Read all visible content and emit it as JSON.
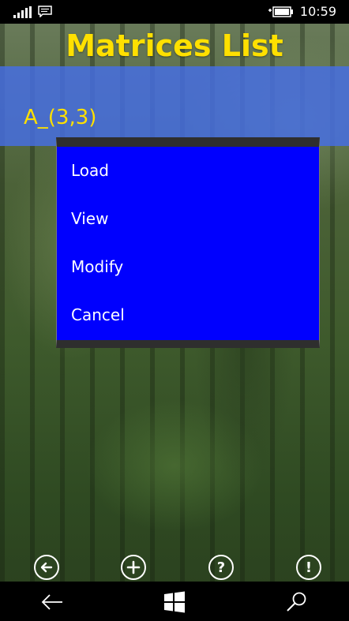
{
  "status_bar": {
    "time": "10:59"
  },
  "page": {
    "title": "Matrices List"
  },
  "list": {
    "items": [
      {
        "label": "A_(3,3)"
      }
    ]
  },
  "context_menu": {
    "items": [
      {
        "label": "Load"
      },
      {
        "label": "View"
      },
      {
        "label": "Modify"
      },
      {
        "label": "Cancel"
      }
    ]
  },
  "app_bar": {
    "buttons": [
      {
        "icon": "back-arrow-icon",
        "glyph": ""
      },
      {
        "icon": "plus-icon",
        "glyph": ""
      },
      {
        "icon": "question-icon",
        "glyph": "?"
      },
      {
        "icon": "exclamation-icon",
        "glyph": "!"
      }
    ]
  },
  "nav_bar": {
    "buttons": [
      {
        "icon": "back-icon"
      },
      {
        "icon": "windows-start-icon"
      },
      {
        "icon": "search-icon"
      }
    ]
  },
  "colors": {
    "title": "#ffe000",
    "list_band": "#466ee6",
    "menu_background": "#0000fe",
    "menu_border": "#2e2e2e",
    "bar_background": "#000000"
  }
}
